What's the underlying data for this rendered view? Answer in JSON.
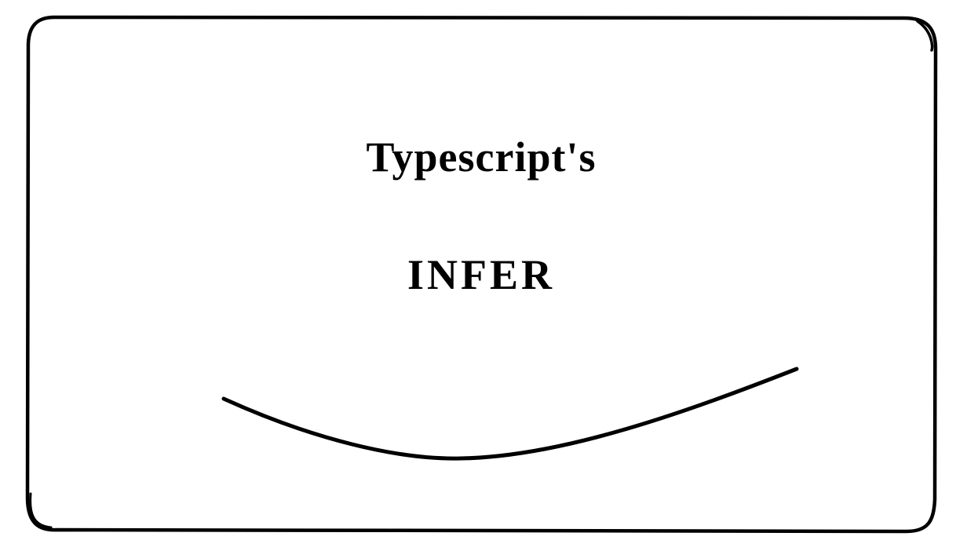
{
  "card": {
    "line1": "Typescript's",
    "line2": "INFER"
  }
}
